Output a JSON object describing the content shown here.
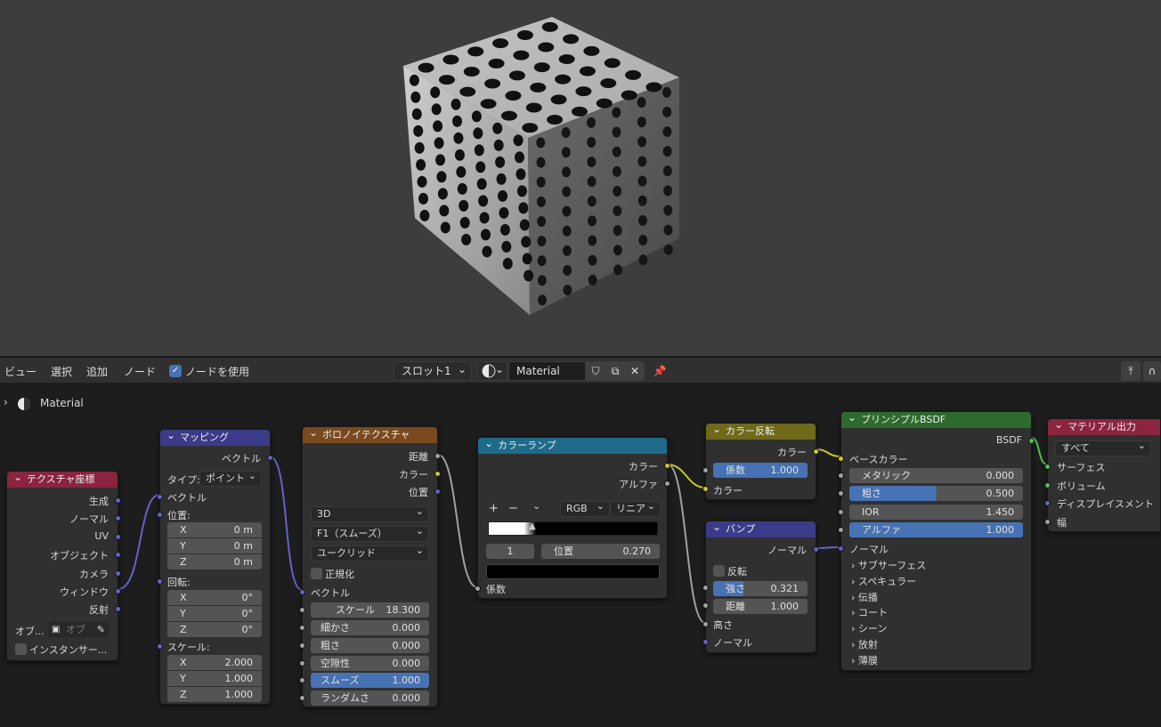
{
  "header": {
    "menus": [
      "ビュー",
      "選択",
      "追加",
      "ノード"
    ],
    "use_nodes_label": "ノードを使用",
    "slot": "スロット1",
    "material_name": "Material"
  },
  "breadcrumb": {
    "label": "Material"
  },
  "nodes": {
    "texcoord": {
      "title": "テクスチャ座標",
      "outputs": [
        "生成",
        "ノーマル",
        "UV",
        "オブジェクト",
        "カメラ",
        "ウィンドウ",
        "反射"
      ],
      "object_label": "オブ...",
      "object_placeholder": "オブ",
      "instancer_label": "インスタンサー..."
    },
    "mapping": {
      "title": "マッピング",
      "output": "ベクトル",
      "type_label": "タイプ:",
      "type_value": "ポイント",
      "vector_label": "ベクトル",
      "location_label": "位置:",
      "location": [
        [
          "X",
          "0 m"
        ],
        [
          "Y",
          "0 m"
        ],
        [
          "Z",
          "0 m"
        ]
      ],
      "rotation_label": "回転:",
      "rotation": [
        [
          "X",
          "0°"
        ],
        [
          "Y",
          "0°"
        ],
        [
          "Z",
          "0°"
        ]
      ],
      "scale_label": "スケール:",
      "scale": [
        [
          "X",
          "2.000"
        ],
        [
          "Y",
          "1.000"
        ],
        [
          "Z",
          "1.000"
        ]
      ]
    },
    "voronoi": {
      "title": "ボロノイテクスチャ",
      "outputs": [
        "距離",
        "カラー",
        "位置"
      ],
      "dimension": "3D",
      "feature": "F1（スムーズ）",
      "metric": "ユークリッド",
      "normalize_label": "正規化",
      "vector_label": "ベクトル",
      "params": [
        [
          "スケール",
          "18.300"
        ],
        [
          "細かさ",
          "0.000"
        ],
        [
          "粗さ",
          "0.000"
        ],
        [
          "空隙性",
          "0.000"
        ],
        [
          "スムーズ",
          "1.000"
        ],
        [
          "ランダムさ",
          "0.000"
        ]
      ]
    },
    "colorramp": {
      "title": "カラーランプ",
      "outputs": [
        "カラー",
        "アルファ"
      ],
      "add": "+",
      "remove": "−",
      "mode": "RGB",
      "interp": "リニア",
      "index": "1",
      "pos_label": "位置",
      "pos_value": "0.270",
      "fac_label": "係数"
    },
    "invert": {
      "title": "カラー反転",
      "output": "カラー",
      "fac_label": "係数",
      "fac_value": "1.000",
      "color_label": "カラー"
    },
    "bump": {
      "title": "バンプ",
      "output": "ノーマル",
      "invert_label": "反転",
      "strength_label": "強さ",
      "strength_value": "0.321",
      "distance_label": "距離",
      "distance_value": "1.000",
      "height_label": "高さ",
      "normal_label": "ノーマル"
    },
    "bsdf": {
      "title": "プリンシプルBSDF",
      "output": "BSDF",
      "base_color": "ベースカラー",
      "params": [
        [
          "メタリック",
          "0.000"
        ],
        [
          "粗さ",
          "0.500"
        ],
        [
          "IOR",
          "1.450"
        ],
        [
          "アルファ",
          "1.000"
        ]
      ],
      "normal": "ノーマル",
      "panels": [
        "サブサーフェス",
        "スペキュラー",
        "伝播",
        "コート",
        "シーン",
        "放射",
        "薄膜"
      ]
    },
    "output": {
      "title": "マテリアル出力",
      "target": "すべて",
      "inputs": [
        "サーフェス",
        "ボリューム",
        "ディスプレイスメント",
        "幅"
      ]
    }
  }
}
